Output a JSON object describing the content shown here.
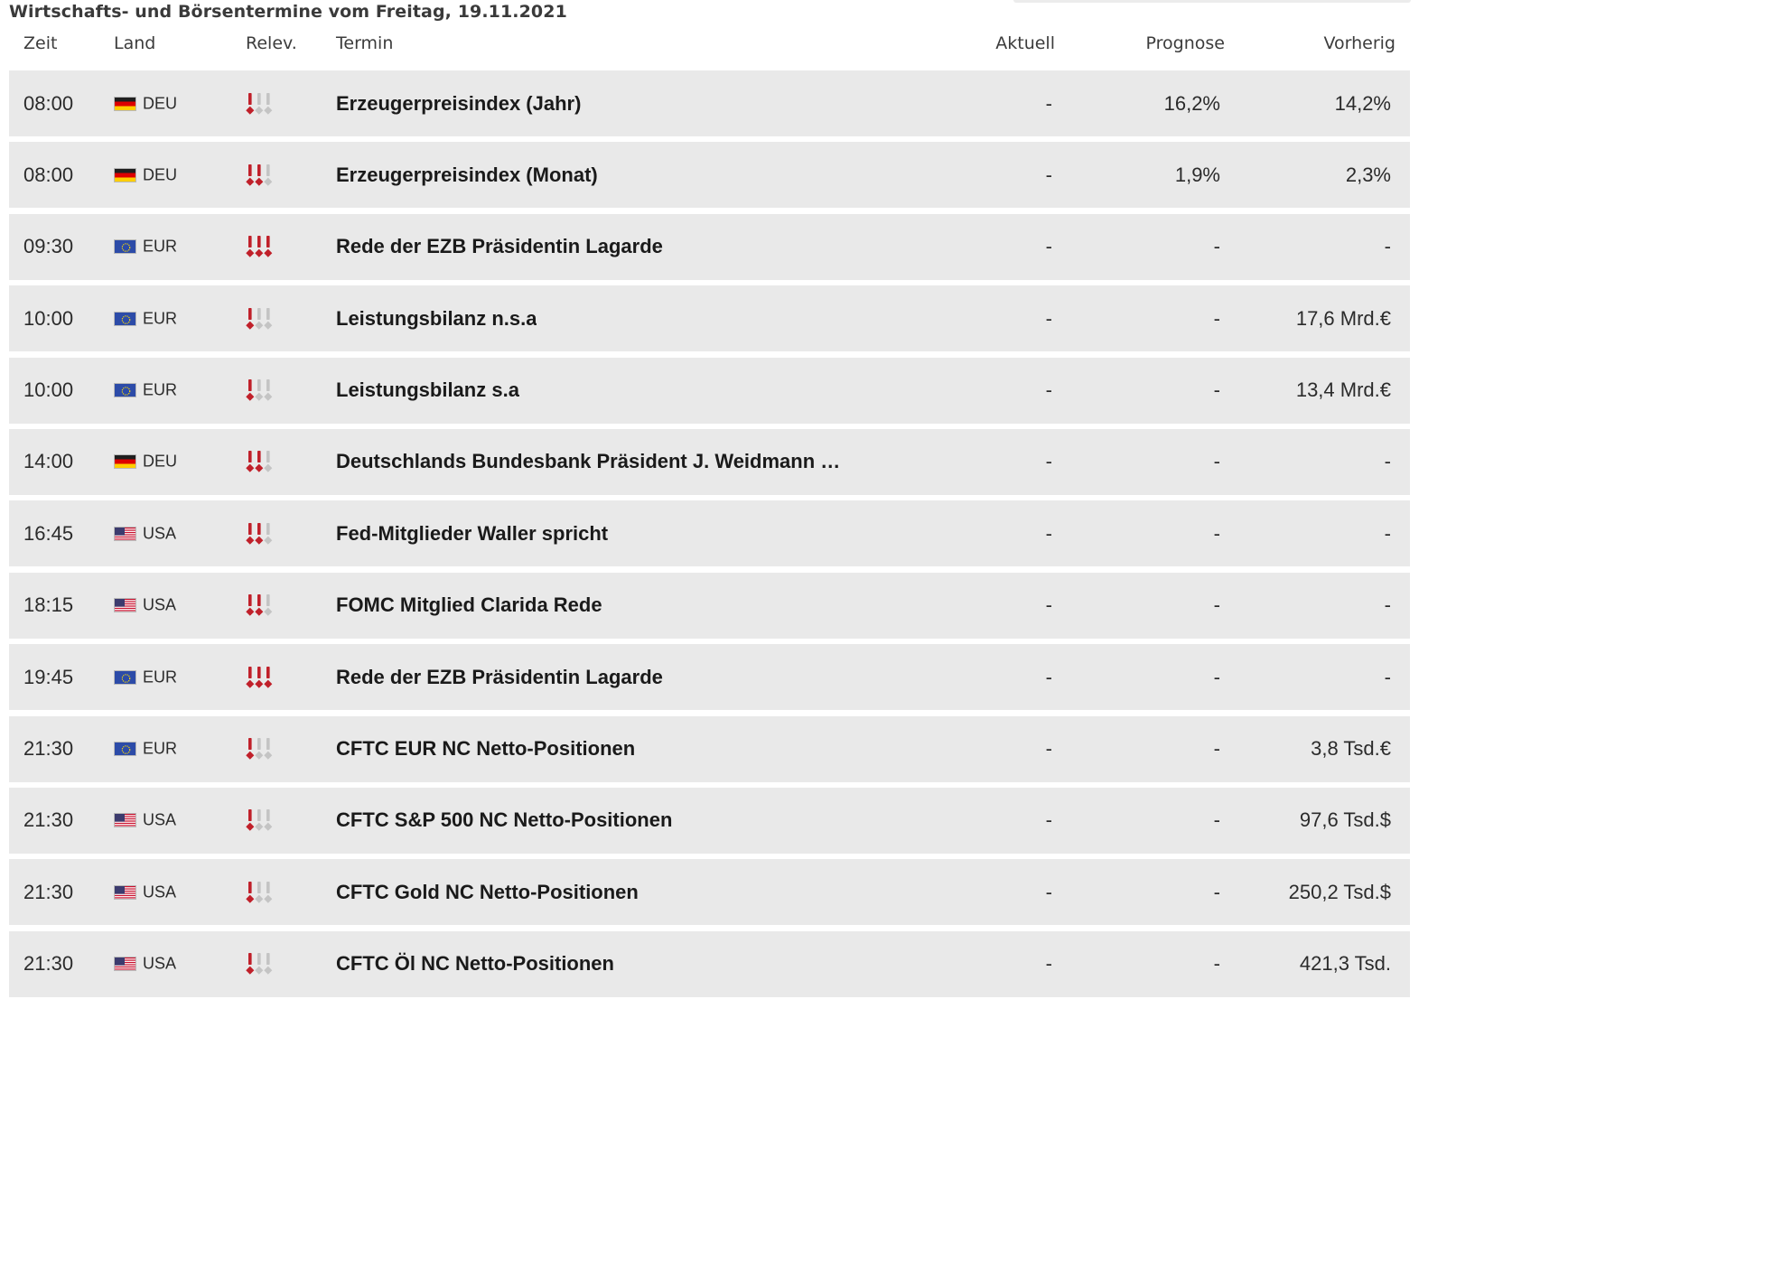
{
  "title": "Wirtschafts- und Börsentermine vom Freitag, 19.11.2021",
  "columns": {
    "zeit": "Zeit",
    "land": "Land",
    "relev": "Relev.",
    "termin": "Termin",
    "aktuell": "Aktuell",
    "prognose": "Prognose",
    "vorherig": "Vorherig"
  },
  "relevance_colors": {
    "active": "#c0202a",
    "inactive": "#c4c4c4"
  },
  "events": [
    {
      "time": "08:00",
      "country": "DEU",
      "flag": "germany-flag-icon",
      "relevance": 1,
      "title": "Erzeugerpreisindex (Jahr)",
      "aktuell": "-",
      "prognose": "16,2%",
      "vorherig": "14,2%"
    },
    {
      "time": "08:00",
      "country": "DEU",
      "flag": "germany-flag-icon",
      "relevance": 2,
      "title": "Erzeugerpreisindex (Monat)",
      "aktuell": "-",
      "prognose": "1,9%",
      "vorherig": "2,3%"
    },
    {
      "time": "09:30",
      "country": "EUR",
      "flag": "eu-flag-icon",
      "relevance": 3,
      "title": "Rede der EZB Präsidentin Lagarde",
      "aktuell": "-",
      "prognose": "-",
      "vorherig": "-"
    },
    {
      "time": "10:00",
      "country": "EUR",
      "flag": "eu-flag-icon",
      "relevance": 1,
      "title": "Leistungsbilanz n.s.a",
      "aktuell": "-",
      "prognose": "-",
      "vorherig": "17,6 Mrd.€"
    },
    {
      "time": "10:00",
      "country": "EUR",
      "flag": "eu-flag-icon",
      "relevance": 1,
      "title": "Leistungsbilanz s.a",
      "aktuell": "-",
      "prognose": "-",
      "vorherig": "13,4 Mrd.€"
    },
    {
      "time": "14:00",
      "country": "DEU",
      "flag": "germany-flag-icon",
      "relevance": 2,
      "title": "Deutschlands Bundesbank Präsident J. Weidmann spri...",
      "aktuell": "-",
      "prognose": "-",
      "vorherig": "-"
    },
    {
      "time": "16:45",
      "country": "USA",
      "flag": "usa-flag-icon",
      "relevance": 2,
      "title": "Fed-Mitglieder Waller spricht",
      "aktuell": "-",
      "prognose": "-",
      "vorherig": "-"
    },
    {
      "time": "18:15",
      "country": "USA",
      "flag": "usa-flag-icon",
      "relevance": 2,
      "title": "FOMC Mitglied Clarida Rede",
      "aktuell": "-",
      "prognose": "-",
      "vorherig": "-"
    },
    {
      "time": "19:45",
      "country": "EUR",
      "flag": "eu-flag-icon",
      "relevance": 3,
      "title": "Rede der EZB Präsidentin Lagarde",
      "aktuell": "-",
      "prognose": "-",
      "vorherig": "-"
    },
    {
      "time": "21:30",
      "country": "EUR",
      "flag": "eu-flag-icon",
      "relevance": 1,
      "title": "CFTC EUR NC Netto-Positionen",
      "aktuell": "-",
      "prognose": "-",
      "vorherig": "3,8 Tsd.€"
    },
    {
      "time": "21:30",
      "country": "USA",
      "flag": "usa-flag-icon",
      "relevance": 1,
      "title": "CFTC S&P 500 NC Netto-Positionen",
      "aktuell": "-",
      "prognose": "-",
      "vorherig": "97,6 Tsd.$"
    },
    {
      "time": "21:30",
      "country": "USA",
      "flag": "usa-flag-icon",
      "relevance": 1,
      "title": "CFTC Gold NC Netto-Positionen",
      "aktuell": "-",
      "prognose": "-",
      "vorherig": "250,2 Tsd.$"
    },
    {
      "time": "21:30",
      "country": "USA",
      "flag": "usa-flag-icon",
      "relevance": 1,
      "title": "CFTC Öl NC Netto-Positionen",
      "aktuell": "-",
      "prognose": "-",
      "vorherig": "421,3 Tsd."
    }
  ]
}
